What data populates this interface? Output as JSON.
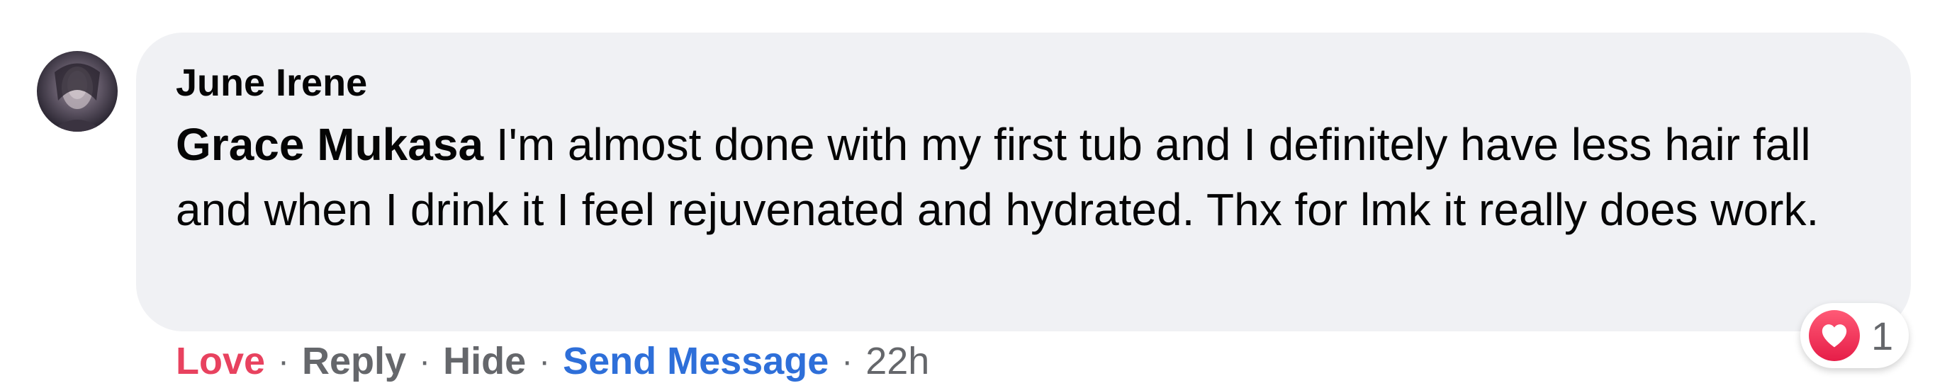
{
  "comment": {
    "author": "June Irene",
    "mention": "Grace Mukasa",
    "text": " I'm almost done with my first tub and I definitely have less hair fall and when I drink it I feel rejuvenated and hydrated. Thx for lmk it really does work.",
    "avatar_icon": "profile-photo"
  },
  "actions": {
    "love": "Love",
    "reply": "Reply",
    "hide": "Hide",
    "send_message": "Send Message",
    "separator": "·",
    "timestamp": "22h"
  },
  "reactions": {
    "icon": "heart-icon",
    "count": "1"
  },
  "colors": {
    "love": "#e8425f",
    "link": "#2e6fd9",
    "muted": "#65676b",
    "bubble": "#f0f1f4"
  }
}
